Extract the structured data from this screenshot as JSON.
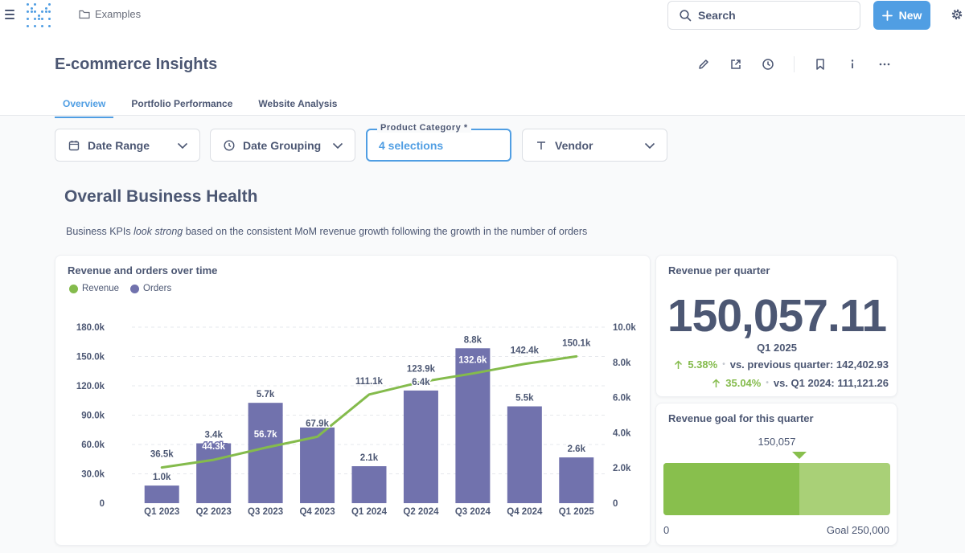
{
  "nav": {
    "breadcrumb": "Examples",
    "search_label": "Search",
    "new_label": "New"
  },
  "dashboard": {
    "title": "E-commerce Insights",
    "tabs": [
      {
        "label": "Overview",
        "active": true
      },
      {
        "label": "Portfolio Performance",
        "active": false
      },
      {
        "label": "Website Analysis",
        "active": false
      }
    ]
  },
  "filters": [
    {
      "label": "Date Range",
      "icon": "calendar-icon"
    },
    {
      "label": "Date Grouping",
      "icon": "clock-icon"
    },
    {
      "legend": "Product Category *",
      "value": "4 selections"
    },
    {
      "label": "Vendor",
      "icon": "text-icon"
    }
  ],
  "section": {
    "title": "Overall Business Health",
    "text_before": "Business KPIs ",
    "text_em": "look strong",
    "text_after": " based on the consistent MoM revenue growth following the growth in the number of orders"
  },
  "revenue_card": {
    "title": "Revenue per quarter",
    "value": "150,057.11",
    "period": "Q1 2025",
    "comparisons": [
      {
        "pct": "5.38%",
        "text": "vs. previous quarter: 142,402.93"
      },
      {
        "pct": "35.04%",
        "text": "vs. Q1 2024: 111,121.26"
      }
    ]
  },
  "goal_card": {
    "title": "Revenue goal for this quarter",
    "value_label": "150,057",
    "value": 150057,
    "goal": 250000,
    "min_label": "0",
    "goal_label": "Goal 250,000"
  },
  "colors": {
    "accent": "#509ee3",
    "revenue": "#84bb4c",
    "orders": "#7172ad",
    "text": "#4c5773"
  },
  "chart_data": {
    "type": "bar",
    "title": "Revenue and orders over time",
    "categories": [
      "Q1 2023",
      "Q2 2023",
      "Q3 2023",
      "Q4 2023",
      "Q1 2024",
      "Q2 2024",
      "Q3 2024",
      "Q4 2024",
      "Q1 2025"
    ],
    "series": [
      {
        "name": "Revenue",
        "type": "line",
        "axis": "left",
        "values": [
          36500,
          44300,
          56700,
          67900,
          111100,
          123900,
          132600,
          142400,
          150100
        ],
        "labels": [
          "36.5k",
          "44.3k",
          "56.7k",
          "67.9k",
          "111.1k",
          "123.9k",
          "132.6k",
          "142.4k",
          "150.1k"
        ]
      },
      {
        "name": "Orders",
        "type": "bar",
        "axis": "right",
        "values": [
          1000,
          3400,
          5700,
          4300,
          2100,
          6400,
          8800,
          5500,
          2600
        ],
        "labels": [
          "1.0k",
          "3.4k",
          "5.7k",
          "",
          "2.1k",
          "6.4k",
          "8.8k",
          "5.5k",
          "2.6k"
        ]
      }
    ],
    "y_left": {
      "range": [
        0,
        180000
      ],
      "ticks": [
        "0",
        "30.0k",
        "60.0k",
        "90.0k",
        "120.0k",
        "150.0k",
        "180.0k"
      ]
    },
    "y_right": {
      "range": [
        0,
        10000
      ],
      "ticks": [
        "0",
        "2.0k",
        "4.0k",
        "6.0k",
        "8.0k",
        "10.0k"
      ]
    },
    "grid": true,
    "legend": "top-left"
  }
}
